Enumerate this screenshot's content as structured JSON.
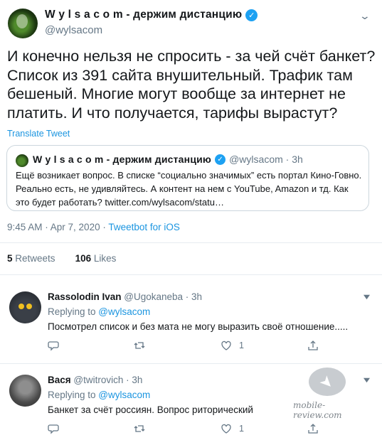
{
  "tweet": {
    "display_name": "W y l s a c o m - держим дистанцию",
    "verified_mark": "✓",
    "handle": "@wylsacom",
    "more_icon": "chevron-down-icon",
    "text": "И конечно нельзя не спросить - за чей счёт банкет? Список из 391 сайта внушительный. Трафик там бешеный. Многие могут вообще за интернет не платить. И что получается, тарифы вырастут?",
    "translate_label": "Translate Tweet",
    "time": "9:45 AM · Apr 7, 2020 · ",
    "source": "Tweetbot for iOS"
  },
  "quote": {
    "display_name": "W y l s a c o m - держим дистанцию",
    "verified_mark": "✓",
    "handle_time": "@wylsacom · 3h",
    "text": "Ещё возникает вопрос. В списке “социально значимых” есть портал Кино-Говно. Реально есть, не удивляйтесь. А контент на нем с YouTube, Amazon и тд. Как это будет работать? twitter.com/wylsacom/statu…"
  },
  "stats": {
    "retweets_count": "5",
    "retweets_label": "Retweets",
    "likes_count": "106",
    "likes_label": "Likes"
  },
  "replies": [
    {
      "name": "Rassolodin Ivan",
      "handle_time": "@Ugokaneba · 3h",
      "replying_prefix": "Replying to ",
      "replying_to": "@wylsacom",
      "text": "Посмотрел список и без мата не могу выразить своё отношение.....",
      "likes": "1"
    },
    {
      "name": "Вася",
      "handle_time": "@twitrovich · 3h",
      "replying_prefix": "Replying to ",
      "replying_to": "@wylsacom",
      "text": "Банкет за счёт россиян. Вопрос риторический",
      "likes": "1"
    }
  ],
  "watermark": {
    "text": "mobile-review.com"
  },
  "colors": {
    "accent": "#1da1f2",
    "link": "#1b95e0",
    "muted": "#657786",
    "border": "#e6ecf0"
  }
}
